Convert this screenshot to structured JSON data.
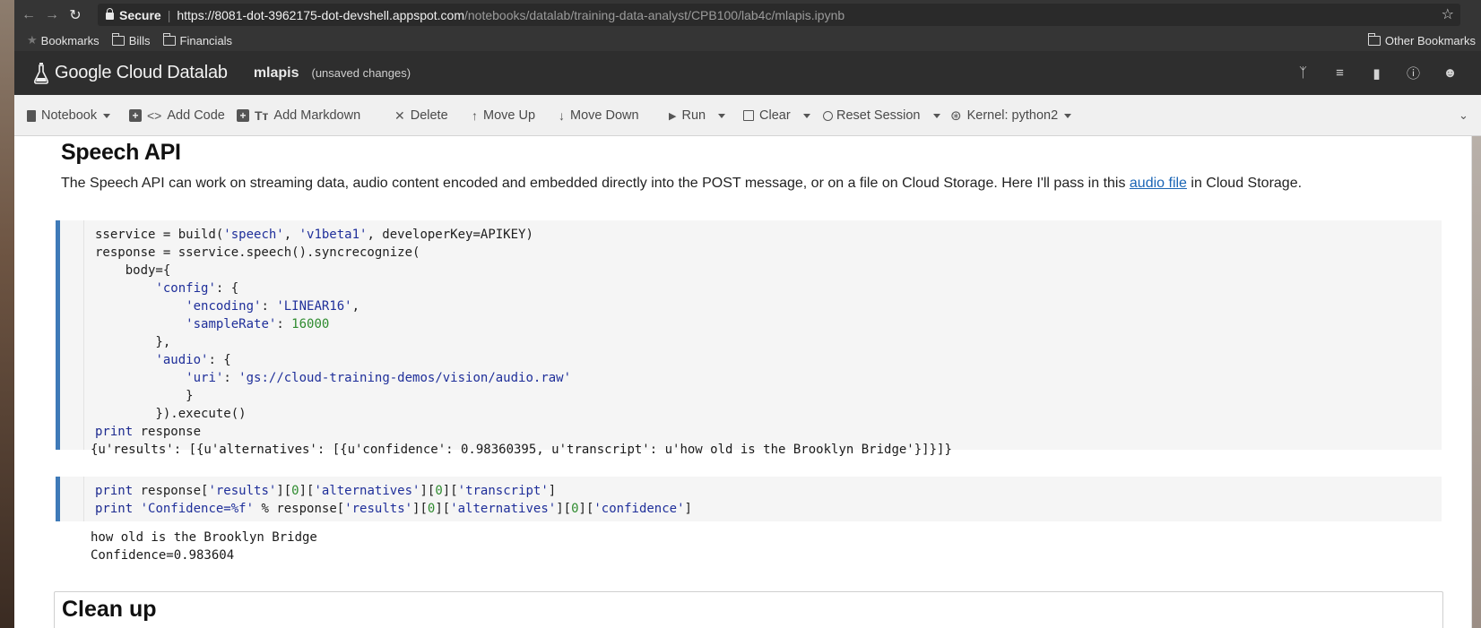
{
  "browser": {
    "secure_label": "Secure",
    "url_host": "https://8081-dot-3962175-dot-devshell.appspot.com",
    "url_path": "/notebooks/datalab/training-data-analyst/CPB100/lab4c/mlapis.ipynb",
    "bookmarks": [
      "Bookmarks",
      "Bills",
      "Financials"
    ],
    "other_bookmarks": "Other Bookmarks"
  },
  "app": {
    "brand": "Google Cloud Datalab",
    "notebook_name": "mlapis",
    "status": "(unsaved changes)"
  },
  "toolbar": {
    "notebook": "Notebook",
    "add_code": "Add Code",
    "add_markdown": "Add Markdown",
    "delete": "Delete",
    "move_up": "Move Up",
    "move_down": "Move Down",
    "run": "Run",
    "clear": "Clear",
    "reset_session": "Reset Session",
    "kernel": "Kernel: python2"
  },
  "notebook": {
    "heading": "Speech API",
    "paragraph_before": "The Speech API can work on streaming data, audio content encoded and embedded directly into the POST message, or on a file on Cloud Storage. Here I'll pass in this ",
    "paragraph_link": "audio file",
    "paragraph_after": " in Cloud Storage.",
    "cell1_lines": [
      "sservice = build('speech', 'v1beta1', developerKey=APIKEY)",
      "response = sservice.speech().syncrecognize(",
      "    body={",
      "        'config': {",
      "            'encoding': 'LINEAR16',",
      "            'sampleRate': 16000",
      "        },",
      "        'audio': {",
      "            'uri': 'gs://cloud-training-demos/vision/audio.raw'",
      "            }",
      "        }).execute()",
      "print response"
    ],
    "output1": "{u'results': [{u'alternatives': [{u'confidence': 0.98360395, u'transcript': u'how old is the Brooklyn Bridge'}]}]}",
    "cell2_lines": [
      "print response['results'][0]['alternatives'][0]['transcript']",
      "print 'Confidence=%f' % response['results'][0]['alternatives'][0]['confidence']"
    ],
    "output2_line1": "how old is the Brooklyn Bridge",
    "output2_line2": "Confidence=0.983604",
    "next_heading": "Clean up"
  }
}
